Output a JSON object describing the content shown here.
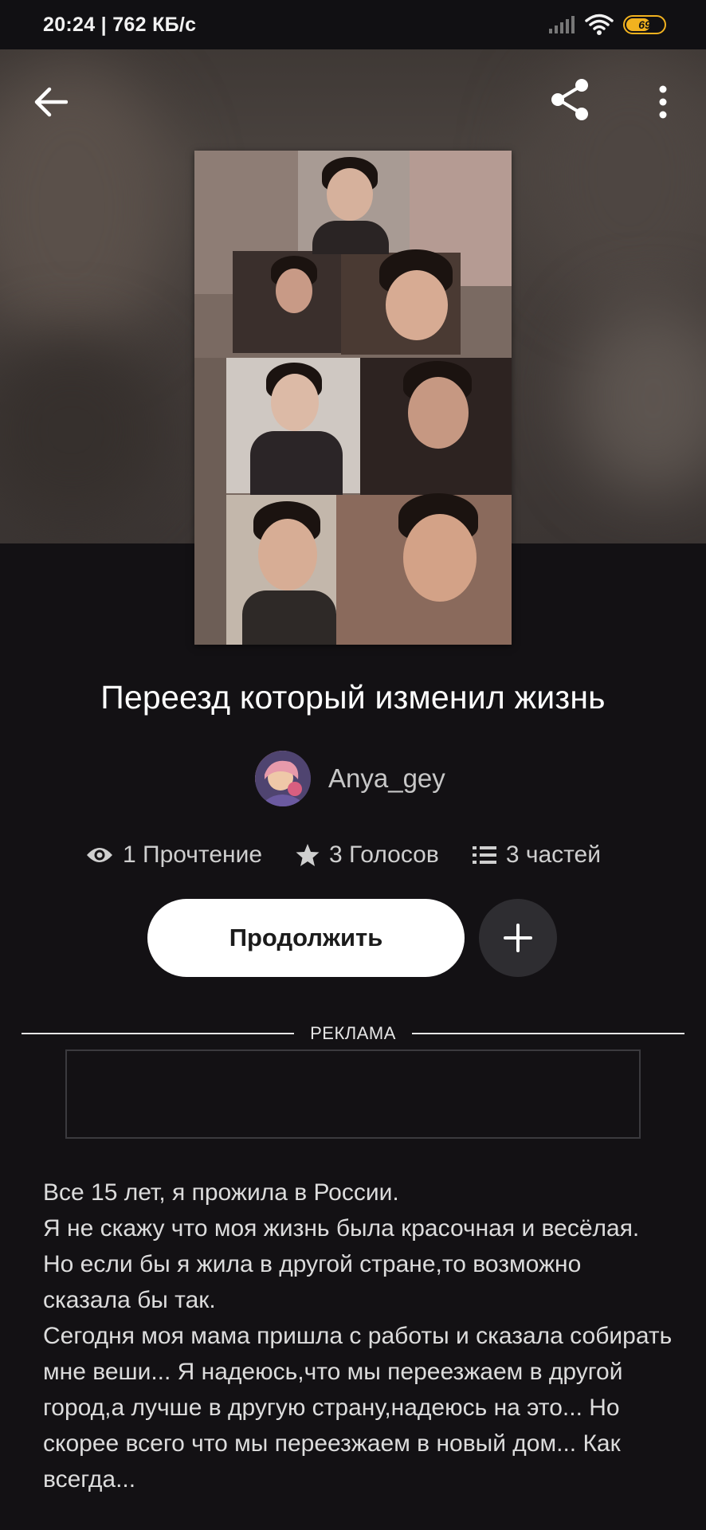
{
  "status_bar": {
    "time_speed": "20:24 | 762 КБ/с",
    "battery_level": "69",
    "icons": [
      "signal-icon",
      "wifi-icon",
      "battery-icon"
    ]
  },
  "nav": {
    "back_icon": "arrow-left-icon",
    "share_icon": "share-icon",
    "more_icon": "more-vertical-icon"
  },
  "book": {
    "title": "Переезд который изменил жизнь",
    "author": "Anya_gey",
    "stats": {
      "reads": "1 Прочтение",
      "votes": "3 Голосов",
      "parts": "3 частей"
    }
  },
  "actions": {
    "continue_label": "Продолжить",
    "add_icon": "plus-icon"
  },
  "ad": {
    "label": "РЕКЛАМА"
  },
  "story_text": "Все 15 лет, я прожила в России.\nЯ не скажу что моя жизнь была красочная и весёлая. Но если бы я жила в другой стране,то возможно сказала бы так.\nСегодня моя мама пришла с работы и сказала собирать мне веши... Я надеюсь,что мы переезжаем в другой город,а лучше в другую страну,надеюсь на это... Но скорее всего что мы переезжаем в новый дом... Как всегда...",
  "colors": {
    "background": "#131114",
    "continue_button": "#ffffff",
    "add_button": "#2e2d31",
    "battery": "#f2b21f"
  }
}
